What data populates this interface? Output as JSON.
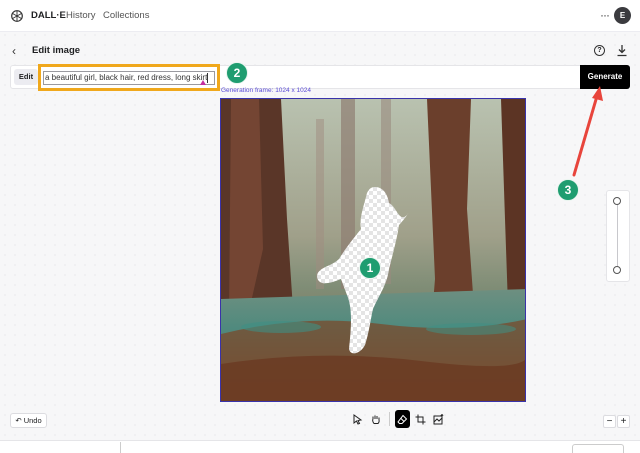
{
  "header": {
    "brand": "DALL·E",
    "nav": [
      "History",
      "Collections"
    ],
    "more_icon": "ellipsis-icon",
    "avatar_initial": "E"
  },
  "page": {
    "title": "Edit image",
    "back_icon": "chevron-left-icon",
    "help_icon": "question-circle-icon",
    "download_icon": "download-icon"
  },
  "prompt": {
    "edit_label": "Edit",
    "value": "a beautiful girl, black hair, red dress, long skirt",
    "generate_label": "Generate"
  },
  "canvas": {
    "frame_label": "Generation frame: 1024 x 1024"
  },
  "annotations": {
    "badges": [
      "1",
      "2",
      "3"
    ],
    "badge_color": "#1f9d70",
    "highlight_color": "#f0a81c",
    "arrow_color": "#e8453c"
  },
  "toolbar": {
    "undo_label": "Undo",
    "tools": [
      "select-tool-icon",
      "hand-tool-icon",
      "eraser-tool-icon",
      "crop-frame-icon",
      "upload-image-icon"
    ],
    "active_tool": "eraser-tool-icon",
    "zoom_out": "−",
    "zoom_in": "+"
  }
}
